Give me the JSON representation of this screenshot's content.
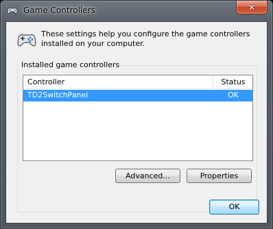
{
  "window": {
    "title": "Game Controllers",
    "close_label": "✕"
  },
  "header": {
    "description": "These settings help you configure the game controllers installed on your computer."
  },
  "group": {
    "label": "Installed game controllers"
  },
  "list": {
    "columns": [
      "Controller",
      "Status"
    ],
    "rows": [
      {
        "controller": "TD2SwitchPanel",
        "status": "OK",
        "selected": true
      }
    ]
  },
  "buttons": {
    "advanced": "Advanced...",
    "properties": "Properties",
    "ok": "OK"
  },
  "icons": {
    "title": "gamepad-icon",
    "header": "gamepad-icon"
  },
  "colors": {
    "selection": "#3399ff"
  }
}
